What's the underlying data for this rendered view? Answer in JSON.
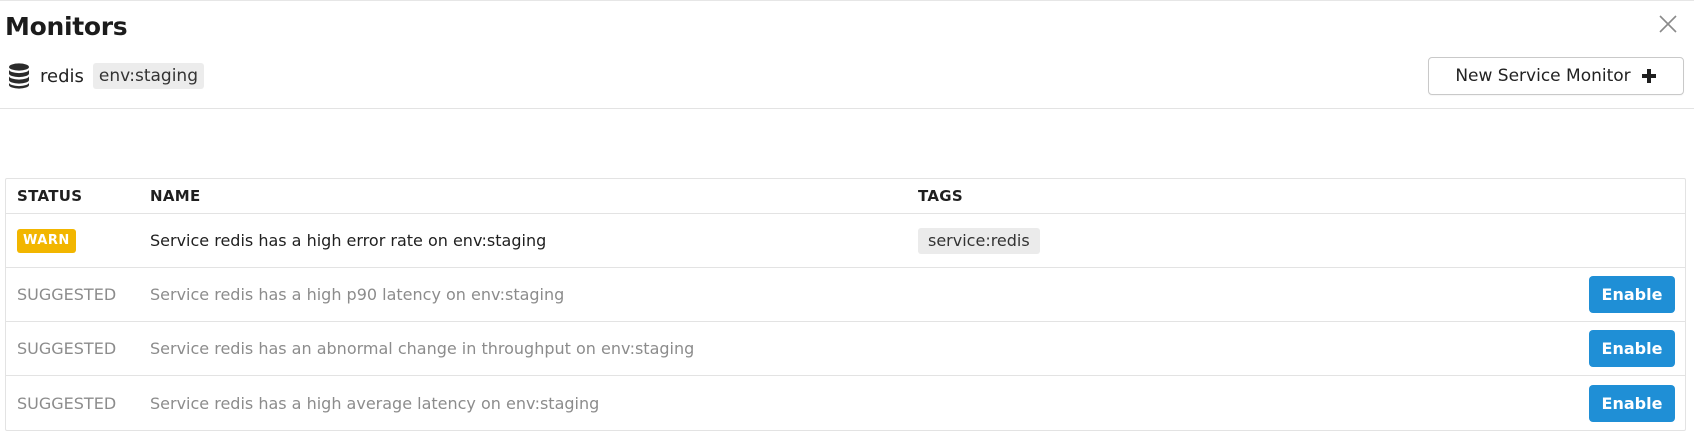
{
  "header": {
    "title": "Monitors",
    "close_icon": "close-icon"
  },
  "service": {
    "icon": "database-icon",
    "name": "redis",
    "env_tag": "env:staging"
  },
  "toolbar": {
    "new_monitor_label": "New Service Monitor",
    "new_monitor_icon": "plus-icon"
  },
  "table": {
    "columns": [
      "STATUS",
      "NAME",
      "TAGS"
    ],
    "rows": [
      {
        "status": "WARN",
        "name": "Service redis has a high error rate on env:staging",
        "tag": "service:redis",
        "action": ""
      },
      {
        "status": "SUGGESTED",
        "name": "Service redis has a high p90 latency on env:staging",
        "tag": "",
        "action": "Enable"
      },
      {
        "status": "SUGGESTED",
        "name": "Service redis has an abnormal change in throughput on env:staging",
        "tag": "",
        "action": "Enable"
      },
      {
        "status": "SUGGESTED",
        "name": "Service redis has a high average latency on env:staging",
        "tag": "",
        "action": "Enable"
      }
    ]
  },
  "colors": {
    "warn": "#f2b600",
    "enable_button": "#1f8fd6",
    "suggested_text": "#8c8c8c"
  }
}
